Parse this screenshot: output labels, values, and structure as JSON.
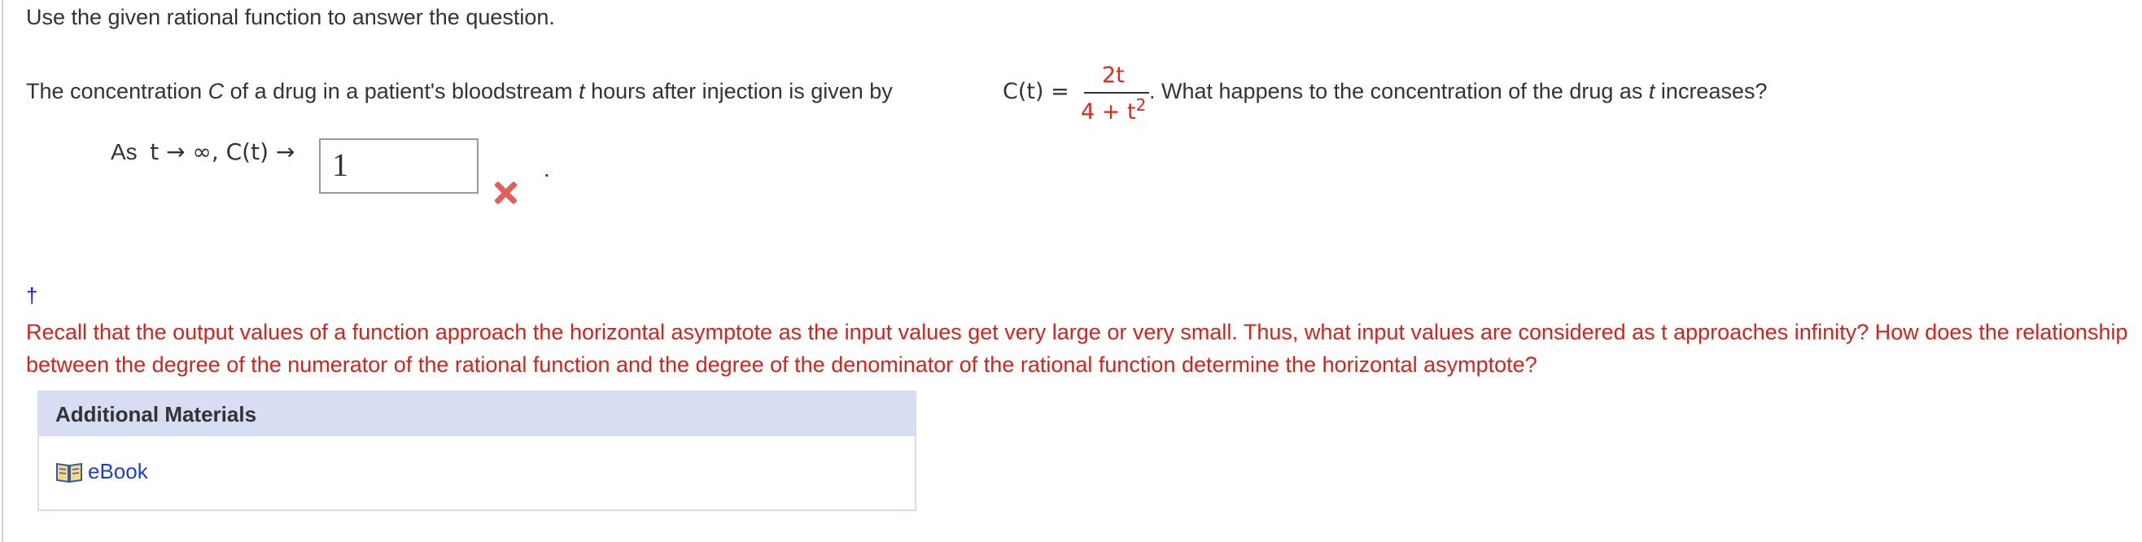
{
  "question": {
    "intro": "Use the given rational function to answer the question.",
    "statement_part1": "The concentration ",
    "var_C": "C",
    "statement_part2": " of a drug in a patient's bloodstream ",
    "var_t": "t",
    "statement_part3": " hours after injection is given by ",
    "func_lhs": "C(t) =",
    "numerator": "2t",
    "denominator": "4 + t",
    "denominator_exp": "2",
    "statement_part4": ".  What happens to the concentration of the drug as ",
    "var_t2": "t",
    "statement_part5": " increases?"
  },
  "answer": {
    "prefix_as": "As",
    "limit_expr": "t → ∞, C(t) →",
    "input_value": "1",
    "period": ".",
    "status": "incorrect",
    "status_icon": "x-icon",
    "status_color": "#e0605a"
  },
  "hint": {
    "dagger": "†",
    "text": "Recall that the output values of a function approach the horizontal asymptote as the input values get very large or very small. Thus, what input values are considered as t approaches infinity? How does the relationship between the degree of the numerator of the rational function and the degree of the denominator of the rational function determine the horizontal asymptote?",
    "color": "#d3231b"
  },
  "materials": {
    "header": "Additional Materials",
    "ebook_label": "eBook",
    "ebook_icon": "book-icon"
  }
}
